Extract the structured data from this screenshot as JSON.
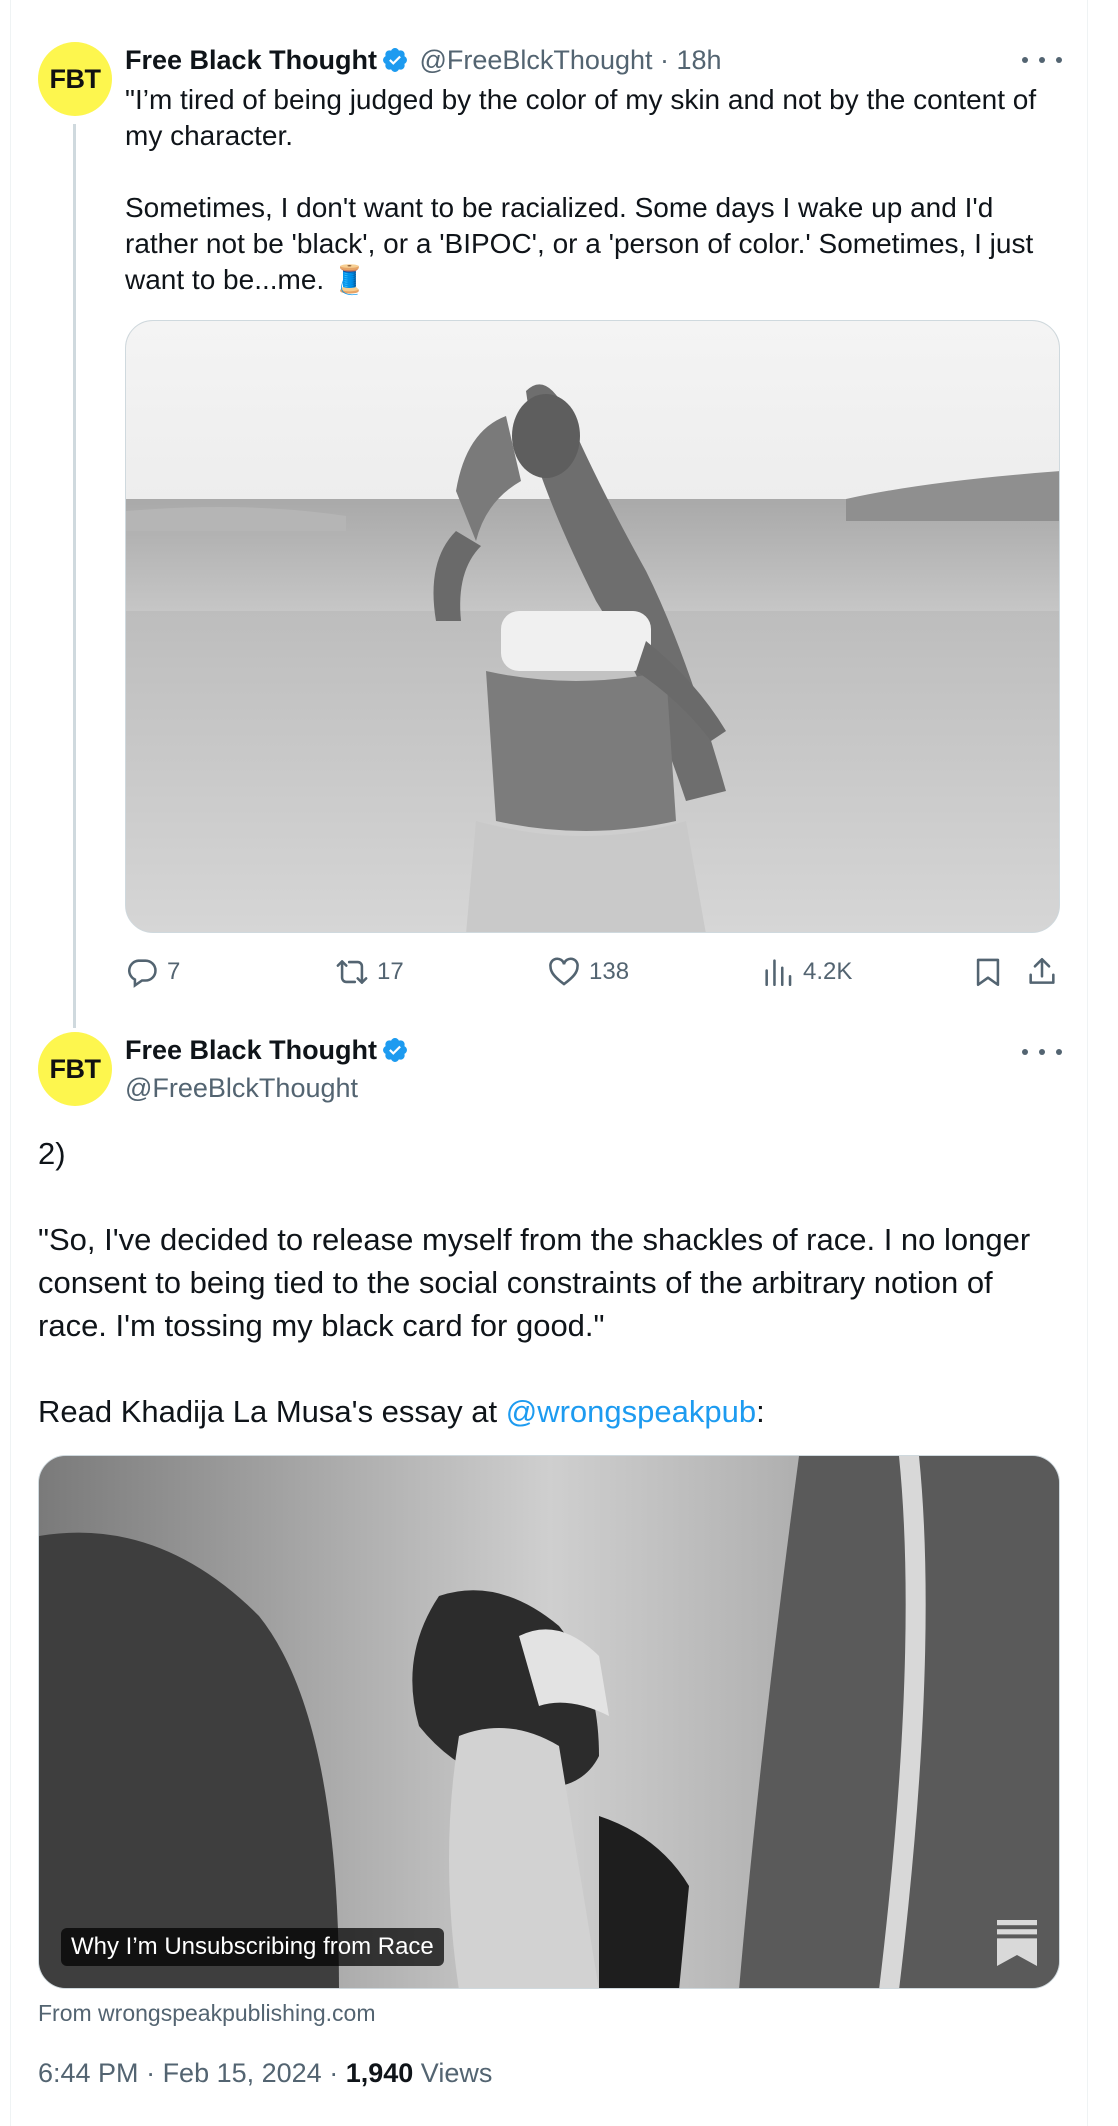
{
  "tweet1": {
    "avatar_text": "FBT",
    "author_name": "Free Black Thought",
    "author_handle": "@FreeBlckThought",
    "separator": " · ",
    "time_ago": "18h",
    "paragraphs": [
      "\"I’m tired of being judged by the color of my skin and not by the content of my character.",
      "Sometimes, I don't want to be racialized. Some days I wake up and I'd rather not be 'black', or a 'BIPOC', or a 'person of color.' Sometimes, I just want to be...me. 🧵"
    ],
    "actions": {
      "replies": "7",
      "reposts": "17",
      "likes": "138",
      "views": "4.2K"
    }
  },
  "tweet2": {
    "avatar_text": "FBT",
    "author_name": "Free Black Thought",
    "author_handle": "@FreeBlckThought",
    "paragraphs": [
      "2)",
      "\"So, I've decided to release myself from the shackles of race. I no longer consent to being tied to the social constraints of the arbitrary notion of race. I'm tossing my black card for good.\""
    ],
    "read_prefix": "Read Khadija La Musa's essay at ",
    "mention": "@wrongspeakpub",
    "read_suffix": ":",
    "card_title": "Why I’m Unsubscribing from Race",
    "card_source": "From wrongspeakpublishing.com",
    "posted_time": "6:44 PM",
    "posted_date": "Feb 15, 2024",
    "views_count": "1,940",
    "views_label": "Views",
    "meta_separator": " · "
  },
  "colors": {
    "avatar_bg": "#fdf64e",
    "verified": "#1d9bf0",
    "link": "#1d9bf0",
    "secondary_text": "#536471"
  },
  "icons": [
    "verified-badge-icon",
    "more-icon",
    "reply-icon",
    "repost-icon",
    "like-icon",
    "views-icon",
    "bookmark-icon",
    "share-icon",
    "substack-icon"
  ]
}
